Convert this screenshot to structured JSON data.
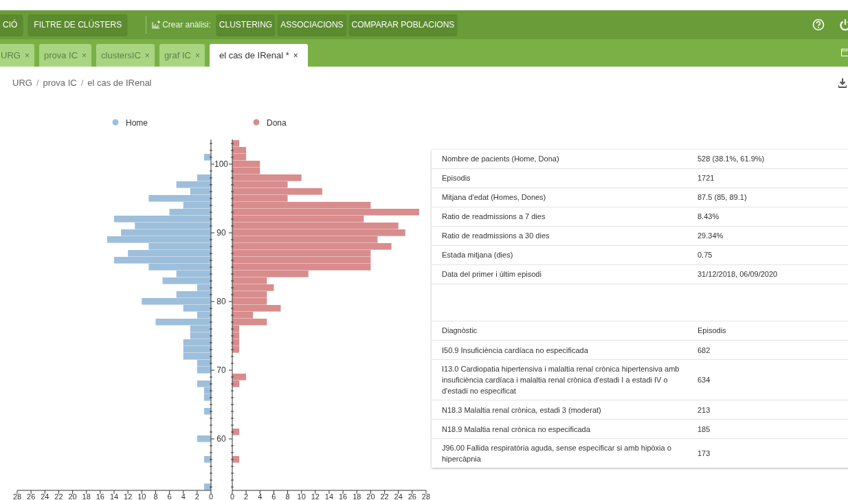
{
  "header": {
    "nav_buttons": [
      "CIÓ",
      "FILTRE DE CLÚSTERS"
    ],
    "create_label": "Crear anàlisi:",
    "analysis_buttons": [
      "CLUSTERING",
      "ASSOCIACIONS",
      "COMPARAR POBLACIONS"
    ]
  },
  "tabs": [
    {
      "label": "URG",
      "close": "×",
      "selected": false
    },
    {
      "label": "prova IC",
      "close": "×",
      "selected": false
    },
    {
      "label": "clustersIC",
      "close": "×",
      "selected": false
    },
    {
      "label": "graf IC",
      "close": "×",
      "selected": false
    },
    {
      "label": "el cas de IRenal *",
      "close": "×",
      "selected": true
    }
  ],
  "breadcrumb": {
    "items": [
      "URG",
      "prova IC",
      "el cas de IRenal"
    ],
    "separators": [
      "/",
      "/"
    ]
  },
  "charts": [
    {
      "chart_data": {
        "type": "bar",
        "orientation": "horizontal",
        "x": [
          103,
          102,
          101,
          100,
          99,
          98,
          97,
          96,
          95,
          94,
          93,
          92,
          91,
          90,
          89,
          88,
          87,
          86,
          85,
          84,
          83,
          82,
          81,
          80,
          79,
          78,
          77,
          76,
          75,
          74,
          73,
          72,
          71,
          70,
          69,
          68,
          67,
          66,
          65,
          64,
          63,
          62,
          61,
          60,
          59,
          58,
          57,
          56,
          55,
          54,
          53
        ],
        "series": [
          {
            "name": "Home",
            "color": "#9dbfdc",
            "values": [
              0,
              0,
              1,
              0,
              0,
              2,
              5,
              3,
              9,
              4,
              6,
              14,
              11,
              13,
              15,
              9,
              12,
              14,
              9,
              5,
              7,
              2,
              5,
              10,
              4,
              2,
              8,
              3,
              3,
              4,
              4,
              4,
              2,
              2,
              0,
              2,
              1,
              1,
              0,
              1,
              0,
              0,
              0,
              2,
              0,
              0,
              1,
              0,
              0,
              0,
              1
            ]
          }
        ],
        "xlim": [
          28,
          0
        ],
        "xticks": [
          28,
          26,
          24,
          22,
          20,
          18,
          16,
          14,
          12,
          10,
          8,
          6,
          4,
          2,
          0
        ],
        "ylim": [
          52.5,
          103.6
        ],
        "yticks": [
          100,
          90,
          80,
          70,
          60
        ]
      }
    },
    {
      "chart_data": {
        "type": "bar",
        "orientation": "horizontal",
        "series": [
          {
            "name": "Dona",
            "color": "#d98c8c",
            "values": [
              1,
              2,
              2,
              4,
              4,
              10,
              8,
              13,
              8,
              20,
              27,
              19,
              24,
              25,
              21,
              23,
              20,
              20,
              20,
              11,
              5,
              6,
              5,
              5,
              7,
              3,
              5,
              1,
              1,
              1,
              1,
              0,
              0,
              0,
              2,
              1,
              0,
              0,
              0,
              0,
              0,
              0,
              1,
              0,
              0,
              0,
              1,
              0,
              0,
              0,
              0
            ]
          }
        ],
        "xlim": [
          0,
          28
        ],
        "xticks": [
          0,
          2,
          4,
          6,
          8,
          10,
          12,
          14,
          16,
          18,
          20,
          22,
          24,
          26,
          28
        ]
      }
    }
  ],
  "summary": [
    {
      "label": "Nombre de pacients (Home, Dona)",
      "value": "528 (38.1%, 61.9%)"
    },
    {
      "label": "Episodis",
      "value": "1721"
    },
    {
      "label": "Mitjana d'edat (Homes, Dones)",
      "value": "87.5 (85, 89.1)"
    },
    {
      "label": "Ratio de readmissions a 7 dies",
      "value": "8.43%"
    },
    {
      "label": "Ratio de readmissions a 30 dies",
      "value": "29.34%"
    },
    {
      "label": "Estada mitjana (dies)",
      "value": "0.75"
    },
    {
      "label": "Data del primer i últim episodi",
      "value": "31/12/2018, 06/09/2020"
    }
  ],
  "diagnoses": {
    "columns": [
      "Diagnòstic",
      "Episodis"
    ],
    "rows": [
      {
        "diagnosis": "I50.9 Insuficiència cardíaca no especificada",
        "episodes": "682"
      },
      {
        "diagnosis": "I13.0 Cardiopatia hipertensiva i malaltia renal crònica hipertensiva amb insuficiència cardíaca i malaltia renal crònica d'estadi I a estadi IV o d'estadi no especificat",
        "episodes": "634"
      },
      {
        "diagnosis": "N18.3 Malaltia renal crònica, estadi 3 (moderat)",
        "episodes": "213"
      },
      {
        "diagnosis": "N18.9 Malaltia renal crònica no especificada",
        "episodes": "185"
      },
      {
        "diagnosis": "J96.00 Fallida respiratòria aguda, sense especificar si amb hipòxia o hipercàpnia",
        "episodes": "173"
      }
    ]
  }
}
